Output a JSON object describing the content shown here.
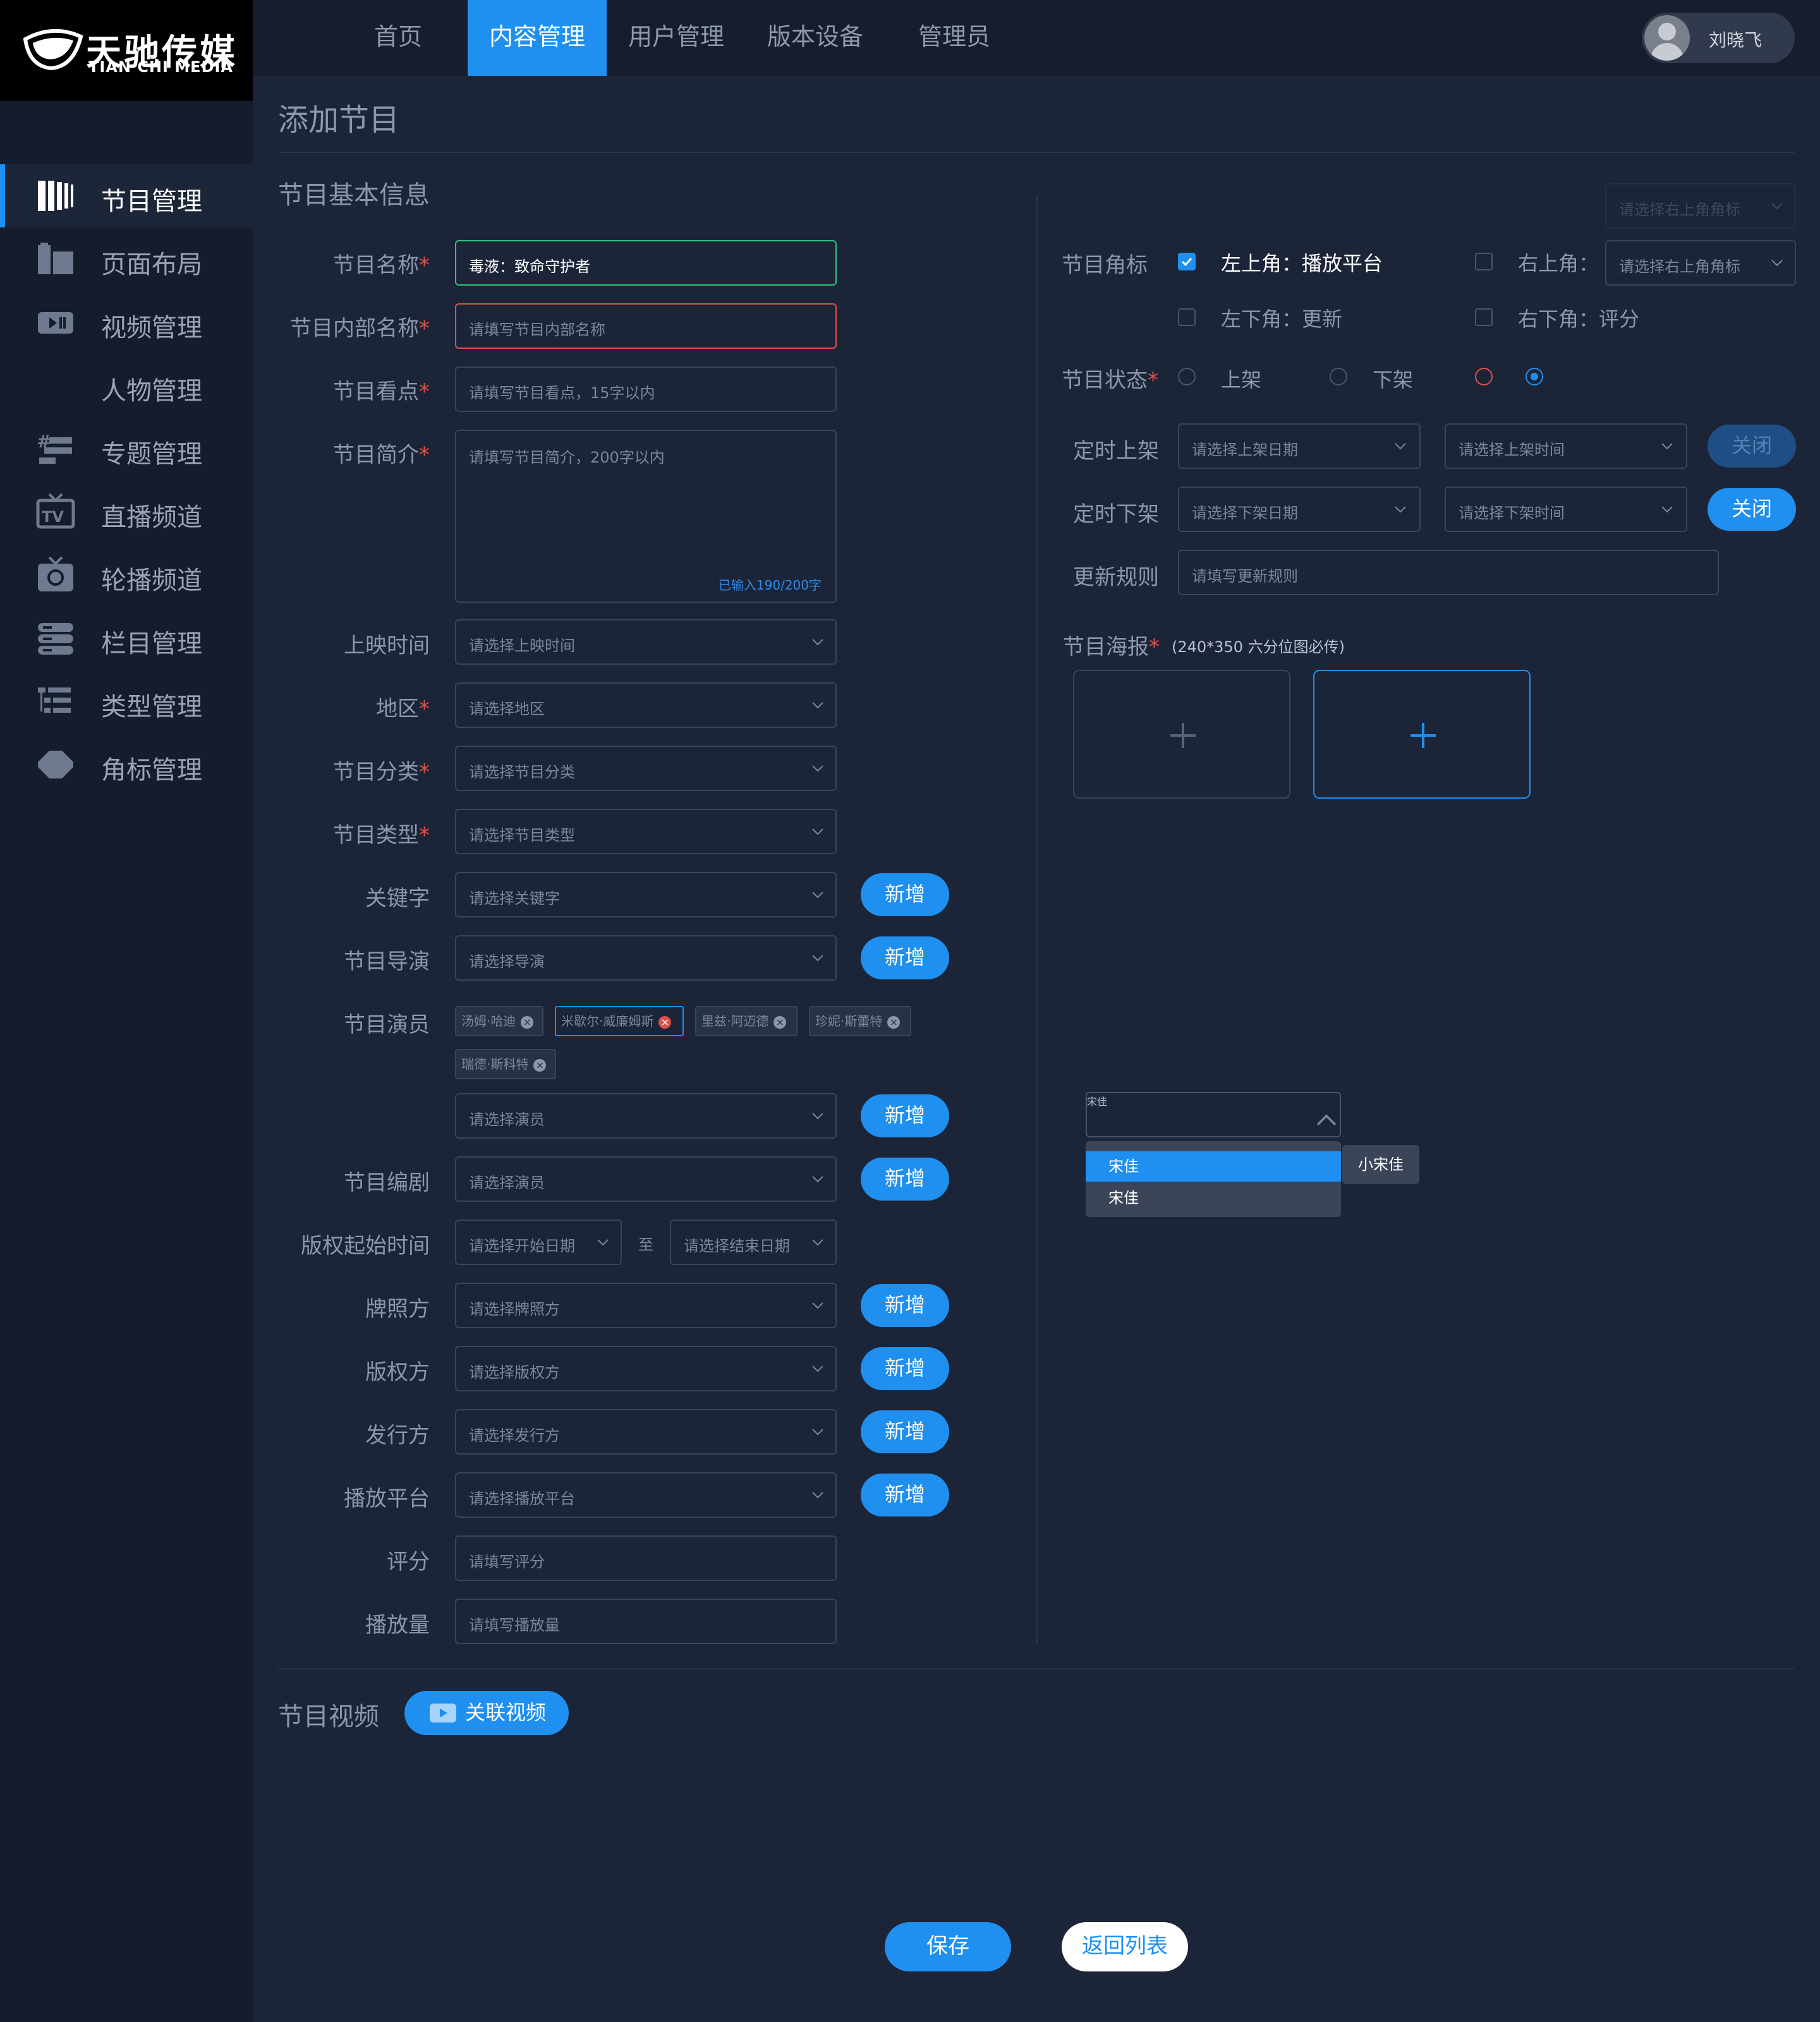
{
  "brand": {
    "name_cn": "天驰传媒",
    "name_en": "TIAN CHI MEDIA"
  },
  "nav": {
    "items": [
      "首页",
      "内容管理",
      "用户管理",
      "版本设备",
      "管理员"
    ],
    "active": "内容管理"
  },
  "user": {
    "name": "刘晓飞"
  },
  "sidebar": {
    "items": [
      {
        "label": "节目管理",
        "icon": "program-icon",
        "active": true
      },
      {
        "label": "页面布局",
        "icon": "layout-icon"
      },
      {
        "label": "视频管理",
        "icon": "video-icon"
      },
      {
        "label": "人物管理",
        "icon": ""
      },
      {
        "label": "专题管理",
        "icon": "topic-icon"
      },
      {
        "label": "直播频道",
        "icon": "tv-icon"
      },
      {
        "label": "轮播频道",
        "icon": "carousel-icon"
      },
      {
        "label": "栏目管理",
        "icon": "column-icon"
      },
      {
        "label": "类型管理",
        "icon": "type-icon"
      },
      {
        "label": "角标管理",
        "icon": "badge-icon"
      }
    ]
  },
  "page": {
    "title": "添加节目",
    "section_basic": "节目基本信息",
    "section_video": "节目视频"
  },
  "form": {
    "name": {
      "label": "节目名称",
      "value": "毒液：致命守护者"
    },
    "internal_name": {
      "label": "节目内部名称",
      "placeholder": "请填写节目内部名称"
    },
    "highlight": {
      "label": "节目看点",
      "placeholder": "请填写节目看点，15字以内"
    },
    "intro": {
      "label": "节目简介",
      "placeholder": "请填写节目简介，200字以内",
      "counter": "已输入190/200字"
    },
    "release_time": {
      "label": "上映时间",
      "placeholder": "请选择上映时间"
    },
    "region": {
      "label": "地区",
      "placeholder": "请选择地区"
    },
    "category": {
      "label": "节目分类",
      "placeholder": "请选择节目分类"
    },
    "type": {
      "label": "节目类型",
      "placeholder": "请选择节目类型"
    },
    "keywords": {
      "label": "关键字",
      "placeholder": "请选择关键字"
    },
    "director": {
      "label": "节目导演",
      "placeholder": "请选择导演"
    },
    "actors": {
      "label": "节目演员",
      "tags": [
        "汤姆·哈迪",
        "米歇尔·威廉姆斯",
        "里兹·阿迈德",
        "珍妮·斯蕾特",
        "瑞德·斯科特"
      ],
      "selected_tag": "米歇尔·威廉姆斯",
      "placeholder": "请选择演员"
    },
    "writer": {
      "label": "节目编剧",
      "placeholder": "请选择演员"
    },
    "copyright": {
      "label": "版权起始时间",
      "start_placeholder": "请选择开始日期",
      "sep": "至",
      "end_placeholder": "请选择结束日期"
    },
    "license": {
      "label": "牌照方",
      "placeholder": "请选择牌照方"
    },
    "copyright_owner": {
      "label": "版权方",
      "placeholder": "请选择版权方"
    },
    "publisher": {
      "label": "发行方",
      "placeholder": "请选择发行方"
    },
    "platform": {
      "label": "播放平台",
      "placeholder": "请选择播放平台"
    },
    "score": {
      "label": "评分",
      "placeholder": "请填写评分"
    },
    "plays": {
      "label": "播放量",
      "placeholder": "请填写播放量"
    },
    "add_button": "新增"
  },
  "right": {
    "ghost_select": "请选择右上角角标",
    "badge": {
      "label": "节目角标",
      "top_left": "左上角：播放平台",
      "top_right": "右上角：",
      "top_right_placeholder": "请选择右上角角标",
      "bottom_left": "左下角：更新",
      "bottom_right": "右下角：评分"
    },
    "status": {
      "label": "节目状态",
      "on": "上架",
      "off": "下架"
    },
    "schedule_on": {
      "label": "定时上架",
      "date_placeholder": "请选择上架日期",
      "time_placeholder": "请选择上架时间",
      "button": "关闭"
    },
    "schedule_off": {
      "label": "定时下架",
      "date_placeholder": "请选择下架日期",
      "time_placeholder": "请选择下架时间",
      "button": "关闭"
    },
    "update_rule": {
      "label": "更新规则",
      "placeholder": "请填写更新规则"
    },
    "poster": {
      "label": "节目海报",
      "hint": "(240*350 六分位图必传)"
    },
    "dropdown": {
      "value": "宋佳",
      "options": [
        "宋佳",
        "宋佳"
      ],
      "tooltip": "小宋佳"
    }
  },
  "actions": {
    "link_video": "关联视频",
    "save": "保存",
    "back": "返回列表"
  },
  "colors": {
    "accent": "#1f8ff0",
    "error": "#e0504b",
    "success": "#2ec27e",
    "background": "#1c2538",
    "sidebar": "#151c2b"
  }
}
